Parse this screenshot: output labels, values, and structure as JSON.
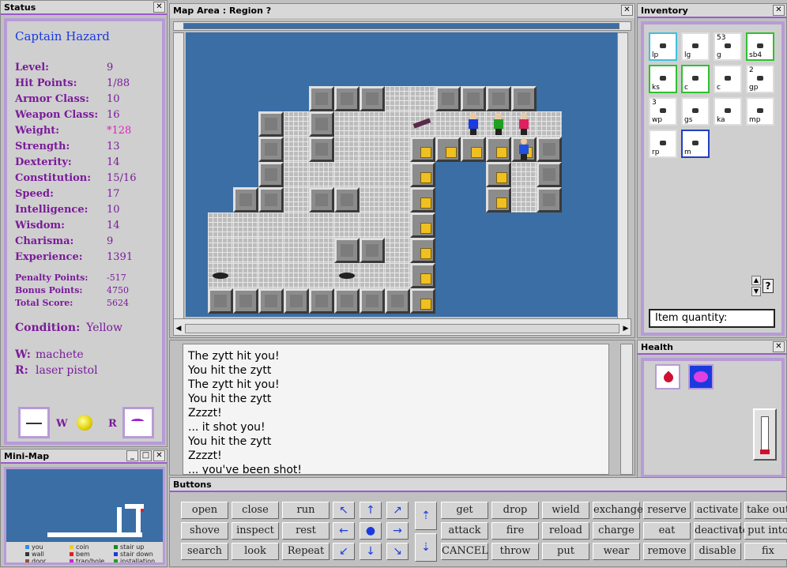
{
  "status": {
    "title": "Status",
    "name": "Captain Hazard",
    "stats": [
      {
        "label": "Level:",
        "value": "9"
      },
      {
        "label": "Hit Points:",
        "value": "1/88"
      },
      {
        "label": "Armor Class:",
        "value": "10"
      },
      {
        "label": "Weapon Class:",
        "value": "16"
      },
      {
        "label": "Weight:",
        "value": "*128"
      },
      {
        "label": "Strength:",
        "value": "13"
      },
      {
        "label": "Dexterity:",
        "value": "14"
      },
      {
        "label": "Constitution:",
        "value": "15/16"
      },
      {
        "label": "Speed:",
        "value": "17"
      },
      {
        "label": "Intelligence:",
        "value": "10"
      },
      {
        "label": "Wisdom:",
        "value": "14"
      },
      {
        "label": "Charisma:",
        "value": "9"
      },
      {
        "label": "Experience:",
        "value": "1391"
      }
    ],
    "points": [
      {
        "label": "Penalty Points:",
        "value": "-517"
      },
      {
        "label": "Bonus Points:",
        "value": "4750"
      },
      {
        "label": "Total Score:",
        "value": "5624"
      }
    ],
    "condition_label": "Condition:",
    "condition_value": "Yellow",
    "w_label": "W:",
    "w_value": "machete",
    "r_label": "R:",
    "r_value": "laser pistol",
    "w_short": "W",
    "r_short": "R"
  },
  "map": {
    "title": "Map Area : Region ?"
  },
  "minimap": {
    "title": "Mini-Map",
    "legend": [
      {
        "label": "you",
        "color": "#2e8de8"
      },
      {
        "label": "coin",
        "color": "#e8d020"
      },
      {
        "label": "stair up",
        "color": "#1a8a1a"
      },
      {
        "label": "wall",
        "color": "#333333"
      },
      {
        "label": "bem",
        "color": "#e02020"
      },
      {
        "label": "stair down",
        "color": "#1a3adf"
      },
      {
        "label": "door",
        "color": "#8b5a2b"
      },
      {
        "label": "trap/hole",
        "color": "#d020d0"
      },
      {
        "label": "installation",
        "color": "#20a020"
      }
    ]
  },
  "messages": [
    "The zytt hit you!",
    "You hit the zytt",
    "The zytt hit you!",
    "You hit the zytt",
    "Zzzzt!",
    "... it shot you!",
    "You hit the zytt",
    "Zzzzt!",
    "... you've been shot!"
  ],
  "inventory": {
    "title": "Inventory",
    "items": [
      {
        "code": "lp",
        "count": ""
      },
      {
        "code": "lg",
        "count": ""
      },
      {
        "code": "g",
        "count": "53"
      },
      {
        "code": "sb4",
        "count": ""
      },
      {
        "code": "ks",
        "count": ""
      },
      {
        "code": "c",
        "count": ""
      },
      {
        "code": "c",
        "count": ""
      },
      {
        "code": "gp",
        "count": "2"
      },
      {
        "code": "wp",
        "count": "3"
      },
      {
        "code": "gs",
        "count": ""
      },
      {
        "code": "ka",
        "count": ""
      },
      {
        "code": "mp",
        "count": ""
      },
      {
        "code": "rp",
        "count": ""
      },
      {
        "code": "m",
        "count": ""
      }
    ],
    "quantity_label": "Item quantity:",
    "help": "?"
  },
  "health": {
    "title": "Health"
  },
  "buttons": {
    "title": "Buttons",
    "left_rows": [
      [
        "open",
        "close",
        "run"
      ],
      [
        "shove",
        "inspect",
        "rest"
      ],
      [
        "search",
        "look",
        "Repeat"
      ]
    ],
    "right_rows": [
      [
        "get",
        "drop",
        "wield",
        "exchange",
        "reserve",
        "activate",
        "take out"
      ],
      [
        "attack",
        "fire",
        "reload",
        "charge",
        "eat",
        "deactivate",
        "put into"
      ],
      [
        "CANCEL",
        "throw",
        "put",
        "wear",
        "remove",
        "disable",
        "fix"
      ]
    ]
  },
  "colors": {
    "accent": "#9b59d0",
    "map_bg": "#3a6ea5",
    "stat_text": "#7a1a9a",
    "name_text": "#1a3adf"
  }
}
